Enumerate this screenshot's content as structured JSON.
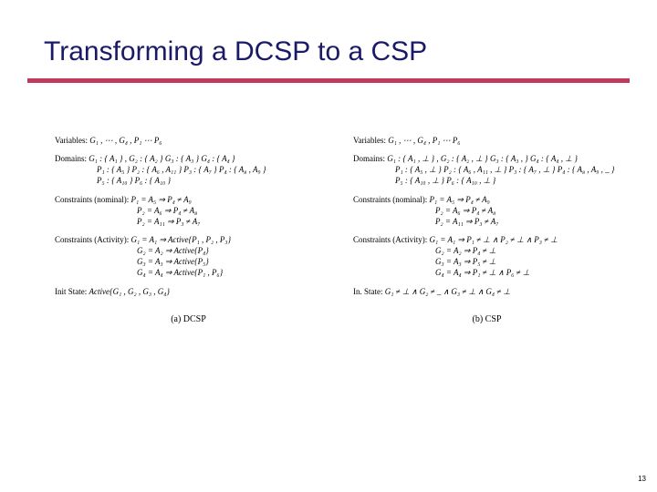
{
  "title": "Transforming a DCSP to a CSP",
  "page_number": "13",
  "left": {
    "caption": "(a) DCSP",
    "labels": {
      "variables": "Variables:",
      "domains": "Domains:",
      "constraints_nominal": "Constraints (nominal):",
      "constraints_activity": "Constraints (Activity):",
      "init_state": "Init State:"
    },
    "variables": "G₁ , ⋯ , G₄ , P₁ ⋯ P₆",
    "domains": [
      "G₁ : { A₁ } , G₂ : { A₂ } G₃ : { A₃ } G₄ : { A₄ }",
      "P₁ : { A₅ } P₂ : { A₆ , A₁₁ } P₃ : { A₇ } P₄ : { A₈ , A₉ }",
      "P₅ : { A₁₀ } P₆ : { A₁₀ }"
    ],
    "constraints_nominal": [
      "P₁ = A₅ ⇒ P₄ ≠ A₉",
      "P₂ = A₆ ⇒ P₄ ≠ A₈",
      "P₂ = A₁₁ ⇒ P₃ ≠ A₇"
    ],
    "constraints_activity": [
      "G₁ = A₁ ⇒ Active{P₁ , P₂ , P₃}",
      "G₂ = A₂ ⇒ Active{P₄}",
      "G₃ = A₃ ⇒ Active{P₅}",
      "G₄ = A₄ ⇒ Active{P₁ , P₆}"
    ],
    "init_state": "Active{G₁ , G₂ , G₃ , G₄}"
  },
  "right": {
    "caption": "(b) CSP",
    "labels": {
      "variables": "Variables:",
      "domains": "Domains:",
      "constraints_nominal": "Constraints (nominal):",
      "constraints_activity": "Constraints (Activity):",
      "init_state": "In. State:"
    },
    "variables": "G₁ , ⋯ , G₄ , P₁ ⋯ P₆",
    "domains": [
      "G₁ : { A₁ , ⊥ } , G₂ : { A₂ , ⊥ } G₃ : { A₃ ,   } G₄ : { A₄ , ⊥ }",
      "P₁ : { A₅ , ⊥ } P₂ : { A₆ , A₁₁ , ⊥ } P₃ : { A₇ , ⊥ } P₄ : { A₈ , A₉ , _ }",
      "P₅ : { A₁₀ , ⊥ } P₆ : { A₁₀ , ⊥ }"
    ],
    "constraints_nominal": [
      "P₁ = A₅ ⇒ P₄ ≠ A₉",
      "P₂ = A₆ ⇒ P₄ ≠ A₈",
      "P₂ = A₁₁ ⇒ P₃ ≠ A₇"
    ],
    "constraints_activity": [
      "G₁ = A₁ ⇒ P₁ ≠ ⊥ ∧ P₂ ≠ ⊥ ∧ P₃ ≠ ⊥",
      "G₂ = A₂ ⇒ P₄ ≠ ⊥",
      "G₃ = A₃ ⇒ P₅ ≠ ⊥",
      "G₄ = A₄ ⇒ P₁ ≠ ⊥ ∧ P₆ ≠ ⊥"
    ],
    "init_state": "G₁ ≠ ⊥ ∧ G₂ ≠ _ ∧ G₃ ≠ ⊥ ∧ G₄ ≠ ⊥"
  }
}
